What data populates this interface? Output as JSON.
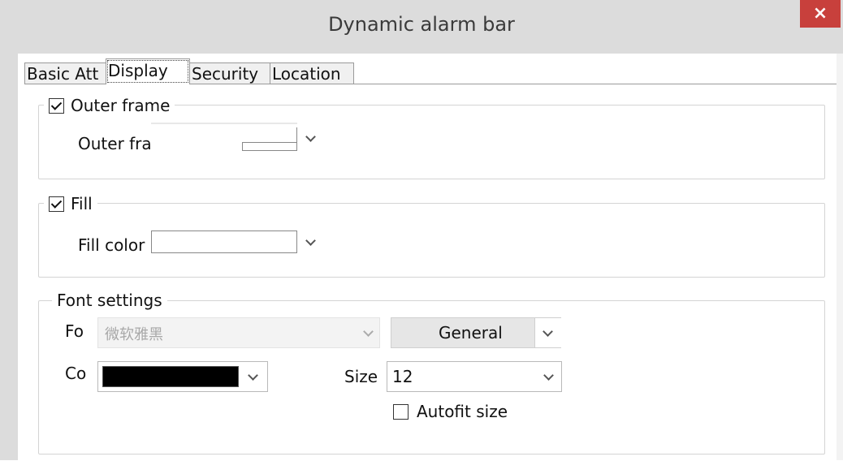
{
  "window": {
    "title": "Dynamic alarm bar",
    "close_symbol": "×"
  },
  "tabs": [
    {
      "label": "Basic Att",
      "active": false
    },
    {
      "label": "Display",
      "active": true
    },
    {
      "label": "Security",
      "active": false
    },
    {
      "label": "Location",
      "active": false
    }
  ],
  "outer_frame": {
    "legend": "Outer frame",
    "checked": true,
    "color_label": "Outer frame color",
    "color_value": "#ffffff"
  },
  "fill": {
    "legend": "Fill",
    "checked": true,
    "color_label": "Fill color",
    "color_value": "#ffffff"
  },
  "font_settings": {
    "legend": "Font settings",
    "font_label": "Fo",
    "font_value": "微软雅黑",
    "style_value": "General",
    "color_label": "Co",
    "color_value": "#000000",
    "size_label": "Size",
    "size_value": "12",
    "autofit_label": "Autofit size",
    "autofit_checked": false
  },
  "colors": {
    "close_button": "#c8403c",
    "titlebar": "#dcdcdc"
  }
}
